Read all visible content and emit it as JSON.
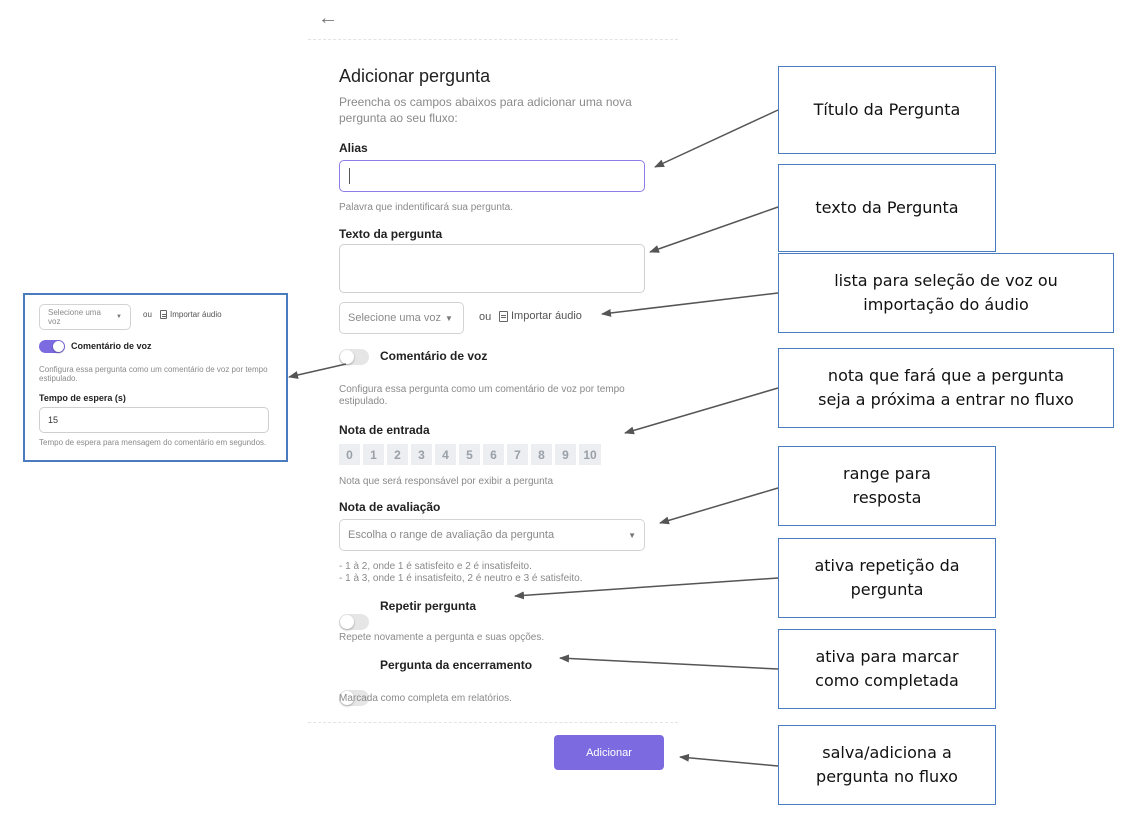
{
  "form": {
    "title": "Adicionar pergunta",
    "subtitle": "Preencha os campos abaixos para adicionar uma nova pergunta ao seu fluxo:",
    "alias": {
      "label": "Alias",
      "value": "",
      "help": "Palavra que indentificará sua pergunta."
    },
    "question_text": {
      "label": "Texto da pergunta",
      "value": ""
    },
    "voice": {
      "select_placeholder": "Selecione uma voz",
      "or_label": "ou",
      "import_label": "Importar áudio"
    },
    "voice_comment": {
      "label": "Comentário de voz",
      "help": "Configura essa pergunta como um comentário de voz por tempo estipulado.",
      "enabled": false
    },
    "entry_note": {
      "label": "Nota de entrada",
      "options": [
        "0",
        "1",
        "2",
        "3",
        "4",
        "5",
        "6",
        "7",
        "8",
        "9",
        "10"
      ],
      "help": "Nota que será responsável por exibir a pergunta"
    },
    "rating": {
      "label": "Nota de avaliação",
      "placeholder": "Escolha o range de avaliação da pergunta",
      "help_line1": "- 1 à 2, onde 1 é satisfeito e 2 é insatisfeito.",
      "help_line2": "- 1 à 3, onde 1 é insatisfeito, 2 é neutro e 3 é satisfeito."
    },
    "repeat": {
      "label": "Repetir pergunta",
      "help": "Repete novamente a pergunta e suas opções.",
      "enabled": false
    },
    "closing": {
      "label": "Pergunta da encerramento",
      "help": "Marcada como completa em relatórios.",
      "enabled": false
    },
    "submit_label": "Adicionar"
  },
  "inset": {
    "select_placeholder": "Selecione uma voz",
    "or_label": "ou",
    "import_label": "Importar áudio",
    "voice_comment_label": "Comentário de voz",
    "voice_comment_enabled": true,
    "voice_comment_help": "Configura essa pergunta como um comentário de voz por tempo estipulado.",
    "wait_label": "Tempo de espera (s)",
    "wait_value": "15",
    "wait_help": "Tempo de espera para mensagem do comentário em segundos."
  },
  "callouts": {
    "title": "Título da Pergunta",
    "text": "texto da Pergunta",
    "voice_line1": "lista para seleção de voz ou",
    "voice_line2": "importação do áudio",
    "entry_line1": "nota que fará que a pergunta",
    "entry_line2": "seja a próxima a entrar no fluxo",
    "range_line1": "range para",
    "range_line2": "resposta",
    "repeat_line1": "ativa repetição da",
    "repeat_line2": "pergunta",
    "closing_line1": "ativa para marcar",
    "closing_line2": "como completada",
    "save_line1": "salva/adiciona a",
    "save_line2": "pergunta no fluxo"
  },
  "colors": {
    "accent": "#7b6ae0",
    "callout_border": "#4a7bbf",
    "arrow": "#555555"
  }
}
